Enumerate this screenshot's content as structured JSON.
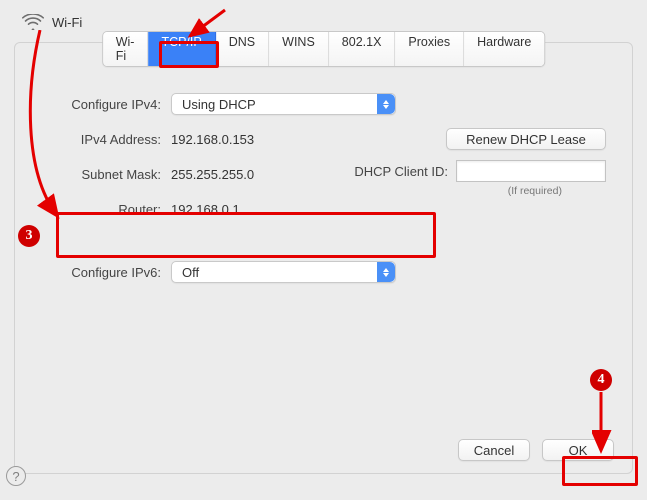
{
  "header": {
    "title": "Wi-Fi"
  },
  "tabs": {
    "items": [
      "Wi-Fi",
      "TCP/IP",
      "DNS",
      "WINS",
      "802.1X",
      "Proxies",
      "Hardware"
    ],
    "active_index": 1
  },
  "ipv4": {
    "configure_label": "Configure IPv4:",
    "configure_value": "Using DHCP",
    "address_label": "IPv4 Address:",
    "address_value": "192.168.0.153",
    "subnet_label": "Subnet Mask:",
    "subnet_value": "255.255.255.0",
    "router_label": "Router:",
    "router_value": "192.168.0.1"
  },
  "dhcp": {
    "renew_label": "Renew DHCP Lease",
    "client_id_label": "DHCP Client ID:",
    "client_id_value": "",
    "if_required": "(If required)"
  },
  "ipv6": {
    "configure_label": "Configure IPv6:",
    "configure_value": "Off"
  },
  "footer": {
    "cancel": "Cancel",
    "ok": "OK"
  },
  "help": "?",
  "annotations": {
    "step3": "3",
    "step4": "4"
  }
}
